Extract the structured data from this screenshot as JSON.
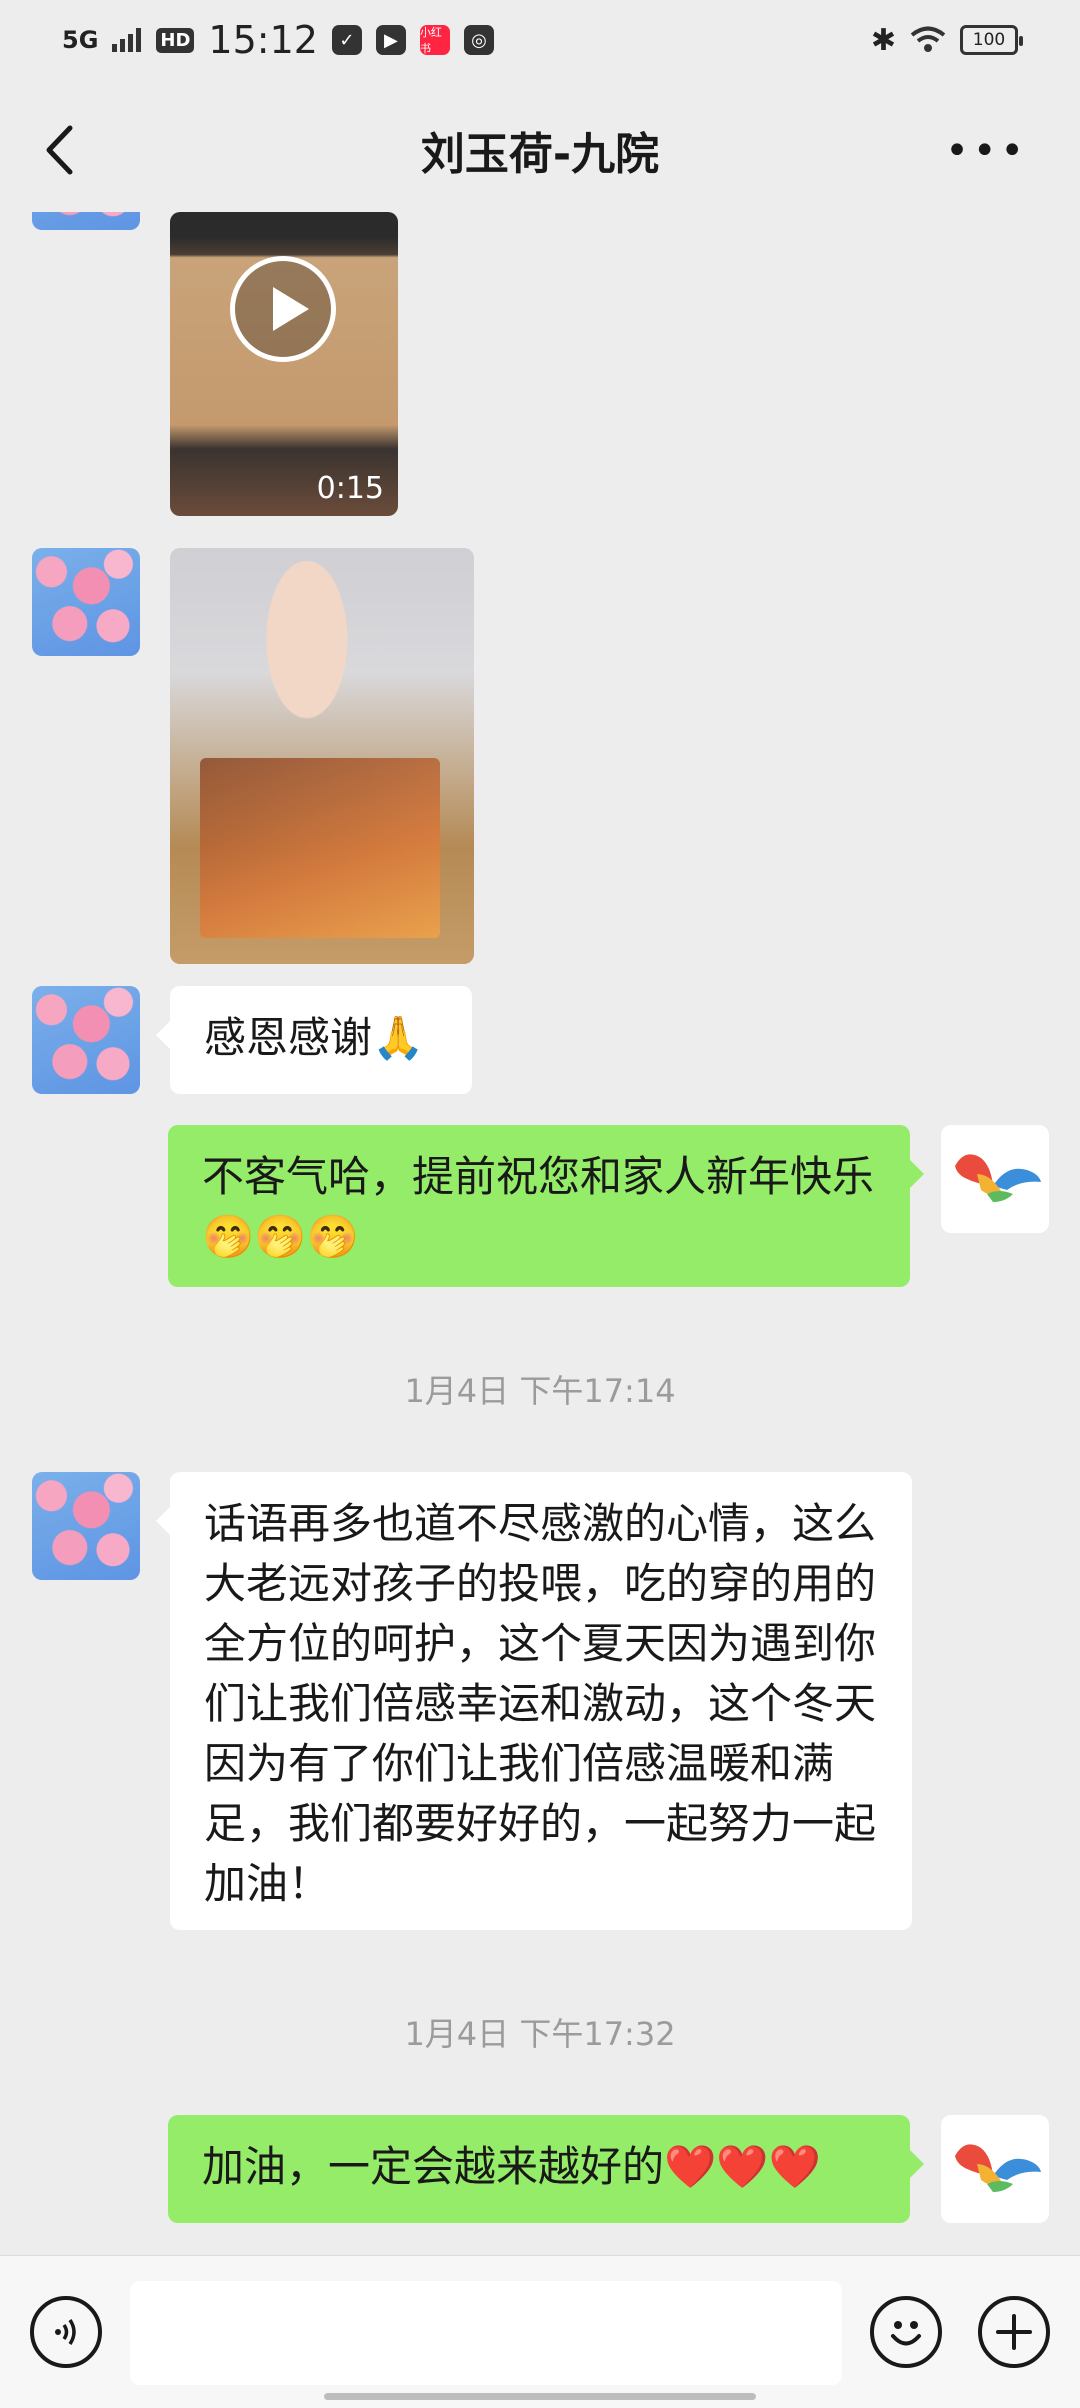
{
  "status_bar": {
    "network": "5G",
    "hd": "HD",
    "time": "15:12",
    "battery": "100"
  },
  "header": {
    "title": "刘玉荷-九院"
  },
  "messages": {
    "video_duration": "0:15",
    "thanks": "感恩感谢🙏",
    "reply1": "不客气哈，提前祝您和家人新年快乐🤭🤭🤭",
    "time1": "1月4日 下午17:14",
    "long": "话语再多也道不尽感激的心情，这么大老远对孩子的投喂，吃的穿的用的全方位的呵护，这个夏天因为遇到你们让我们倍感幸运和激动，这个冬天因为有了你们让我们倍感温暖和满足，我们都要好好的，一起努力一起加油！",
    "time2": "1月4日 下午17:32",
    "reply2": "加油，一定会越来越好的❤️❤️❤️"
  },
  "colors": {
    "background": "#ededed",
    "bubble_sent": "#95ec69",
    "bubble_received": "#ffffff",
    "timestamp": "#9b9b9b"
  },
  "icons": [
    "back-arrow-icon",
    "more-icon",
    "voice-icon",
    "emoji-icon",
    "plus-icon",
    "play-icon"
  ]
}
